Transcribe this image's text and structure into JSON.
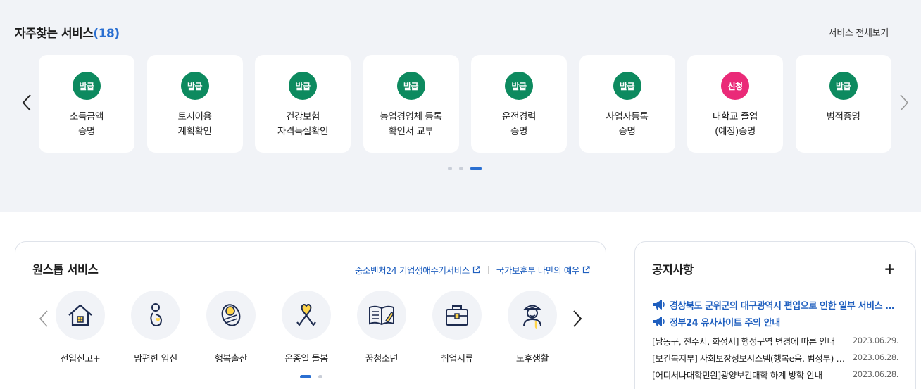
{
  "frequent": {
    "title": "자주찾는 서비스",
    "count_open": "(",
    "count": "18",
    "count_close": ")",
    "view_all": "서비스 전체보기",
    "cards": [
      {
        "badge": "발급",
        "label": "소득금액\n증명"
      },
      {
        "badge": "발급",
        "label": "토지이용\n계획확인"
      },
      {
        "badge": "발급",
        "label": "건강보험\n자격득실확인"
      },
      {
        "badge": "발급",
        "label": "농업경영체 등록\n확인서 교부"
      },
      {
        "badge": "발급",
        "label": "운전경력\n증명"
      },
      {
        "badge": "발급",
        "label": "사업자등록\n증명"
      },
      {
        "badge": "신청",
        "label": "대학교 졸업\n(예정)증명"
      },
      {
        "badge": "발급",
        "label": "병적증명"
      }
    ],
    "pagination": {
      "total": 3,
      "current": 3
    }
  },
  "colors": {
    "issue_badge": "#0d8a5f",
    "apply_badge": "#ea2a78",
    "accent": "#2a6fd1"
  },
  "onestop": {
    "title": "원스톱 서비스",
    "links": [
      "중소벤처24 기업생애주기서비스",
      "국가보훈부 나만의 예우"
    ],
    "services": [
      {
        "icon": "house-icon",
        "label": "전입신고+"
      },
      {
        "icon": "pregnant-icon",
        "label": "맘편한 임신"
      },
      {
        "icon": "baby-icon",
        "label": "행복출산"
      },
      {
        "icon": "ribbon-icon",
        "label": "온종일 돌봄"
      },
      {
        "icon": "book-icon",
        "label": "꿈청소년"
      },
      {
        "icon": "briefcase-icon",
        "label": "취업서류"
      },
      {
        "icon": "elder-icon",
        "label": "노후생활"
      }
    ],
    "pagination": {
      "total": 2,
      "current": 1
    }
  },
  "notice": {
    "title": "공지사항",
    "more": "+",
    "highlights": [
      "경상북도 군위군의 대구광역시 편입으로 인한 일부 서비스 이용 안내",
      "정부24 유사사이트 주의 안내"
    ],
    "items": [
      {
        "title": "[남동구, 전주시, 화성시] 행정구역 변경에 따른 안내",
        "date": "2023.06.29."
      },
      {
        "title": "[보건복지부] 사회보장정보시스템(행복e음, 범정부) 작업 안내",
        "date": "2023.06.28."
      },
      {
        "title": "[어디서나대학민원]광양보건대학 하계 방학 안내",
        "date": "2023.06.28."
      }
    ]
  }
}
